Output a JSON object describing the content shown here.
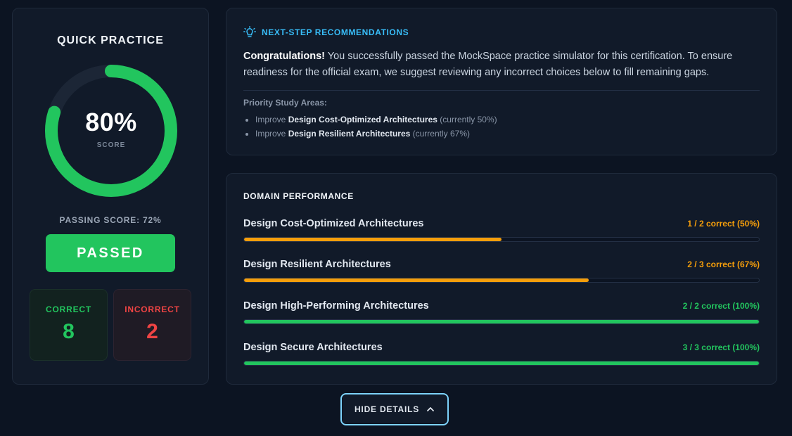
{
  "score_card": {
    "title": "QUICK PRACTICE",
    "score_percent": 80,
    "score_text": "80%",
    "score_label": "SCORE",
    "passing_text": "PASSING SCORE: 72%",
    "result_label": "PASSED",
    "correct_label": "CORRECT",
    "correct_count": "8",
    "incorrect_label": "INCORRECT",
    "incorrect_count": "2"
  },
  "recommendations": {
    "heading": "NEXT-STEP RECOMMENDATIONS",
    "intro_bold": "Congratulations!",
    "intro_text": " You successfully passed the MockSpace practice simulator for this certification. To ensure readiness for the official exam, we suggest reviewing any incorrect choices below to fill remaining gaps.",
    "priority_title": "Priority Study Areas:",
    "items": [
      {
        "prefix": "Improve ",
        "domain": "Design Cost-Optimized Architectures",
        "suffix": " (currently 50%)"
      },
      {
        "prefix": "Improve ",
        "domain": "Design Resilient Architectures",
        "suffix": " (currently 67%)"
      }
    ]
  },
  "domain_performance": {
    "title": "DOMAIN PERFORMANCE",
    "domains": [
      {
        "name": "Design Cost-Optimized Architectures",
        "score_text": "1 / 2 correct (50%)",
        "percent": 50,
        "color": "#f59e0b"
      },
      {
        "name": "Design Resilient Architectures",
        "score_text": "2 / 3 correct (67%)",
        "percent": 67,
        "color": "#f59e0b"
      },
      {
        "name": "Design High-Performing Architectures",
        "score_text": "2 / 2 correct (100%)",
        "percent": 100,
        "color": "#22c55e"
      },
      {
        "name": "Design Secure Architectures",
        "score_text": "3 / 3 correct (100%)",
        "percent": 100,
        "color": "#22c55e"
      }
    ]
  },
  "hide_button": {
    "label": "HIDE DETAILS",
    "icon": "chevron-up-icon"
  },
  "colors": {
    "accent": "#38bdf8",
    "pass_green": "#22c55e",
    "warn_orange": "#f59e0b",
    "fail_red": "#ef4444"
  }
}
